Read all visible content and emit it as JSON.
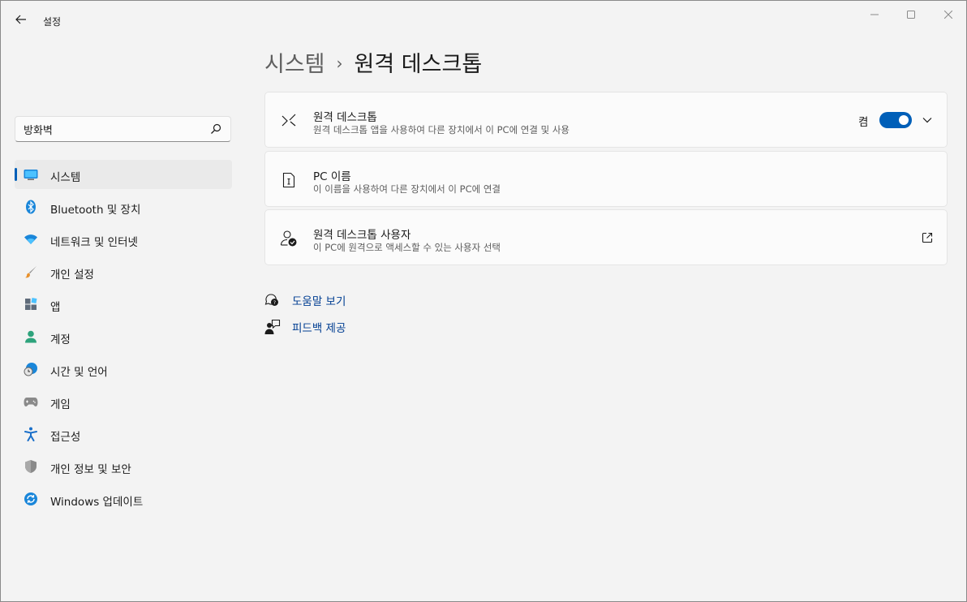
{
  "window": {
    "title": "설정"
  },
  "search": {
    "value": "방화벽",
    "icon": "search-icon"
  },
  "sidebar": {
    "items": [
      {
        "label": "시스템",
        "icon": "monitor-icon",
        "selected": true
      },
      {
        "label": "Bluetooth 및 장치",
        "icon": "bluetooth-icon"
      },
      {
        "label": "네트워크 및 인터넷",
        "icon": "wifi-icon"
      },
      {
        "label": "개인 설정",
        "icon": "brush-icon"
      },
      {
        "label": "앱",
        "icon": "apps-icon"
      },
      {
        "label": "계정",
        "icon": "person-icon"
      },
      {
        "label": "시간 및 언어",
        "icon": "clock-globe-icon"
      },
      {
        "label": "게임",
        "icon": "gamepad-icon"
      },
      {
        "label": "접근성",
        "icon": "accessibility-icon"
      },
      {
        "label": "개인 정보 및 보안",
        "icon": "shield-icon"
      },
      {
        "label": "Windows 업데이트",
        "icon": "update-icon"
      }
    ]
  },
  "breadcrumb": {
    "parent": "시스템",
    "separator": "›",
    "current": "원격 데스크톱"
  },
  "cards": [
    {
      "title": "원격 데스크톱",
      "description": "원격 데스크톱 앱을 사용하여 다른 장치에서 이 PC에 연결 및 사용",
      "icon": "remote-desktop-icon",
      "toggle_label": "켬",
      "toggle_on": true
    },
    {
      "title": "PC 이름",
      "description": "이 이름을 사용하여 다른 장치에서 이 PC에 연결",
      "icon": "pc-name-icon"
    },
    {
      "title": "원격 데스크톱 사용자",
      "description": "이 PC에 원격으로 액세스할 수 있는 사용자 선택",
      "icon": "user-check-icon"
    }
  ],
  "links": {
    "help": "도움말 보기",
    "feedback": "피드백 제공"
  },
  "colors": {
    "accent": "#005fb8",
    "link": "#003e92",
    "background": "#f3f3f3",
    "card": "#fbfbfb"
  }
}
